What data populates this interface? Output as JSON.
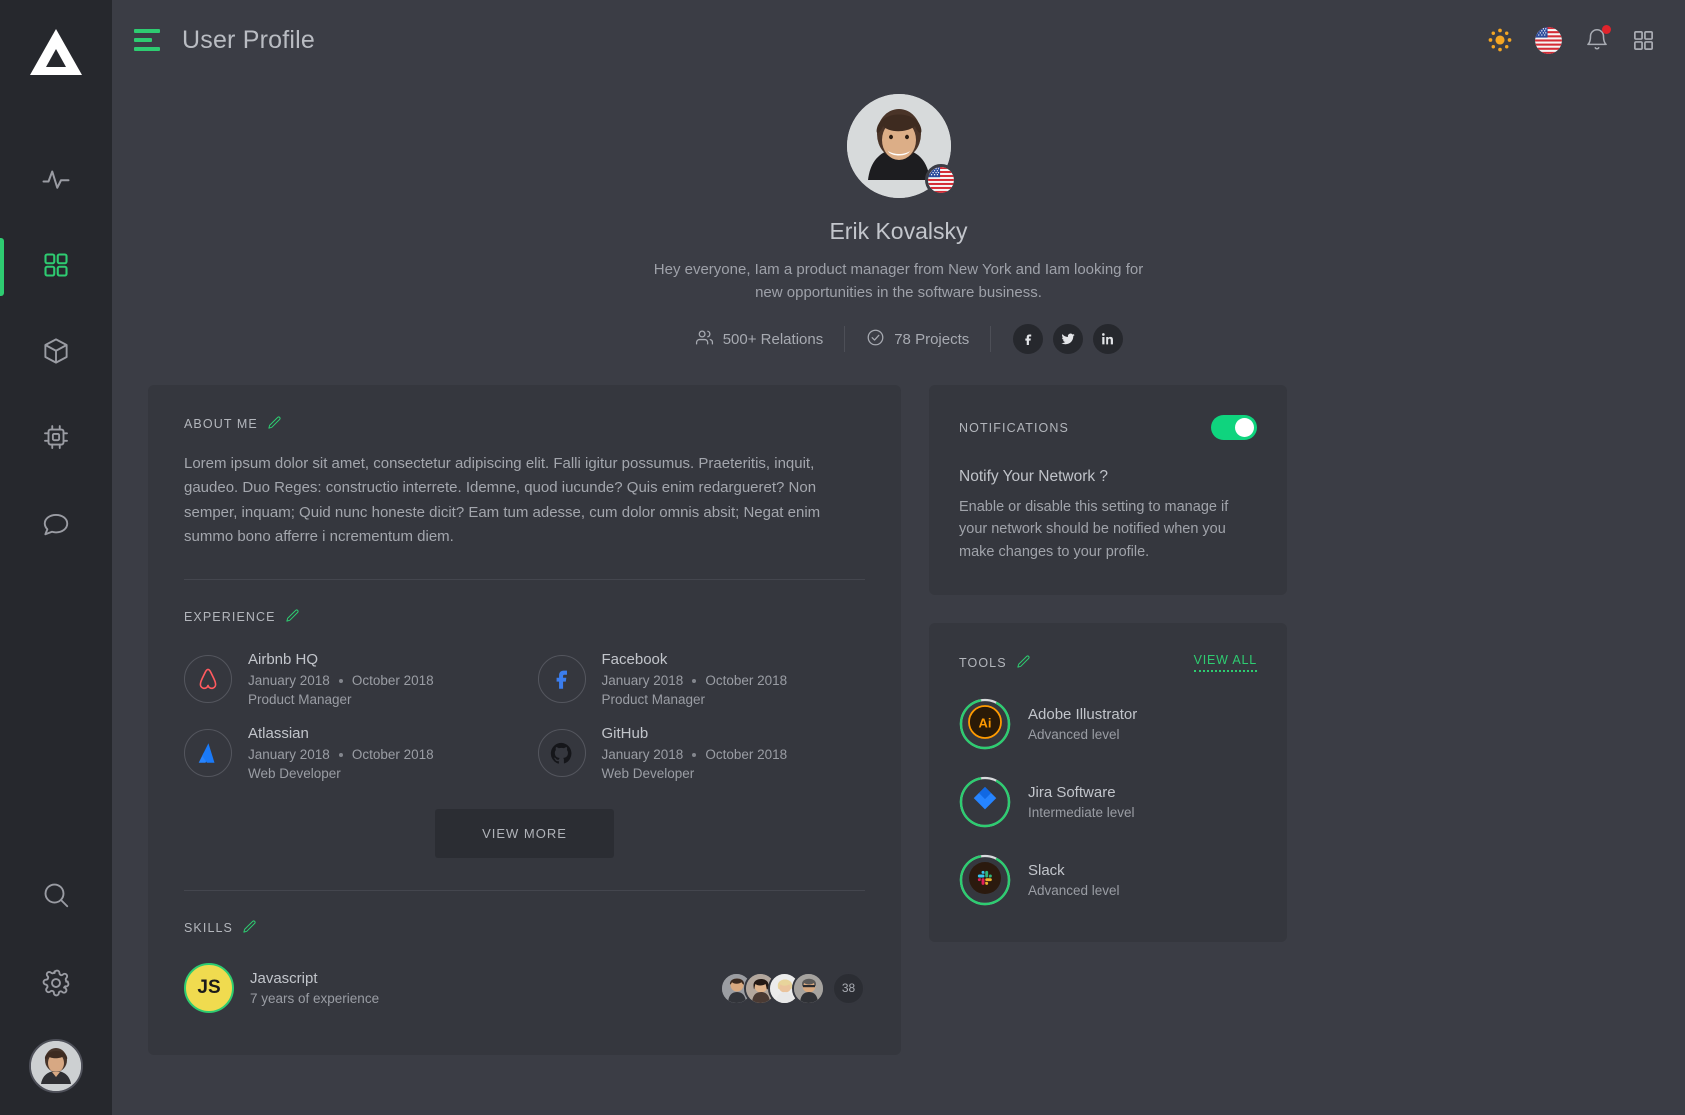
{
  "sidebar": {
    "logo_icon": "triangle-logo",
    "items": [
      {
        "name": "activity",
        "icon": "pulse-icon",
        "active": false
      },
      {
        "name": "dashboard",
        "icon": "grid-icon",
        "active": true
      },
      {
        "name": "packages",
        "icon": "cube-icon",
        "active": false
      },
      {
        "name": "hardware",
        "icon": "chip-icon",
        "active": false
      },
      {
        "name": "messages",
        "icon": "chat-icon",
        "active": false
      }
    ],
    "bottom_items": [
      {
        "name": "search",
        "icon": "search-icon"
      },
      {
        "name": "settings",
        "icon": "gear-icon"
      }
    ],
    "avatar_name": "user-avatar"
  },
  "header": {
    "menu_icon": "hamburger-icon",
    "title": "User Profile",
    "actions": [
      {
        "name": "theme-toggle",
        "icon": "sun-icon"
      },
      {
        "name": "language",
        "icon": "us-flag-icon"
      },
      {
        "name": "notifications",
        "icon": "bell-icon",
        "badge": true
      },
      {
        "name": "apps",
        "icon": "apps-grid-icon"
      }
    ]
  },
  "profile": {
    "name": "Erik Kovalsky",
    "bio": "Hey everyone,  Iam a product manager from New York and Iam looking for new opportunities in the software business.",
    "country_flag": "us-flag-icon",
    "stats": [
      {
        "icon": "people-icon",
        "label": "500+ Relations"
      },
      {
        "icon": "check-circle-icon",
        "label": "78 Projects"
      }
    ],
    "socials": [
      {
        "name": "facebook",
        "glyph": "f"
      },
      {
        "name": "twitter",
        "glyph": "t"
      },
      {
        "name": "linkedin",
        "glyph": "in"
      }
    ]
  },
  "about": {
    "title": "ABOUT ME",
    "edit_icon": "pencil-icon",
    "text": "Lorem ipsum dolor sit amet, consectetur adipiscing elit. Falli igitur possumus. Praeteritis, inquit, gaudeo. Duo Reges: constructio interrete. Idemne, quod iucunde? Quis enim redargueret? Non semper, inquam; Quid nunc honeste dicit? Eam tum adesse, cum dolor omnis absit; Negat enim summo bono afferre i ncrementum diem."
  },
  "experience": {
    "title": "EXPERIENCE",
    "edit_icon": "pencil-icon",
    "items": [
      {
        "company": "Airbnb HQ",
        "logo": "airbnb-logo",
        "start": "January 2018",
        "end": "October 2018",
        "role": "Product Manager"
      },
      {
        "company": "Facebook",
        "logo": "facebook-logo",
        "start": "January 2018",
        "end": "October 2018",
        "role": "Product Manager"
      },
      {
        "company": "Atlassian",
        "logo": "atlassian-logo",
        "start": "January 2018",
        "end": "October 2018",
        "role": "Web Developer"
      },
      {
        "company": "GitHub",
        "logo": "github-logo",
        "start": "January 2018",
        "end": "October 2018",
        "role": "Web Developer"
      }
    ],
    "view_more_label": "VIEW MORE"
  },
  "skills": {
    "title": "SKILLS",
    "edit_icon": "pencil-icon",
    "items": [
      {
        "badge": "JS",
        "name": "Javascript",
        "experience": "7 years of experience",
        "extra_count": "38"
      }
    ]
  },
  "notifications": {
    "title": "NOTIFICATIONS",
    "enabled": true,
    "question": "Notify Your Network ?",
    "description": "Enable or disable this setting to manage if your network should be notified when you make changes to your profile."
  },
  "tools": {
    "title": "TOOLS",
    "edit_icon": "pencil-icon",
    "view_all_label": "VIEW ALL",
    "items": [
      {
        "name": "Adobe Illustrator",
        "level": "Advanced level",
        "logo": "adobe-illustrator-logo",
        "progress": 88
      },
      {
        "name": "Jira Software",
        "level": "Intermediate level",
        "logo": "jira-logo",
        "progress": 88
      },
      {
        "name": "Slack",
        "level": "Advanced level",
        "logo": "slack-logo",
        "progress": 88
      }
    ]
  },
  "colors": {
    "accent_green": "#2ecc71",
    "toggle_green": "#0fd47e",
    "bg": "#3b3d45",
    "card": "#35373e",
    "sidebar": "#26282d",
    "badge_red": "#e0242c",
    "sun_orange": "#f5a623"
  }
}
